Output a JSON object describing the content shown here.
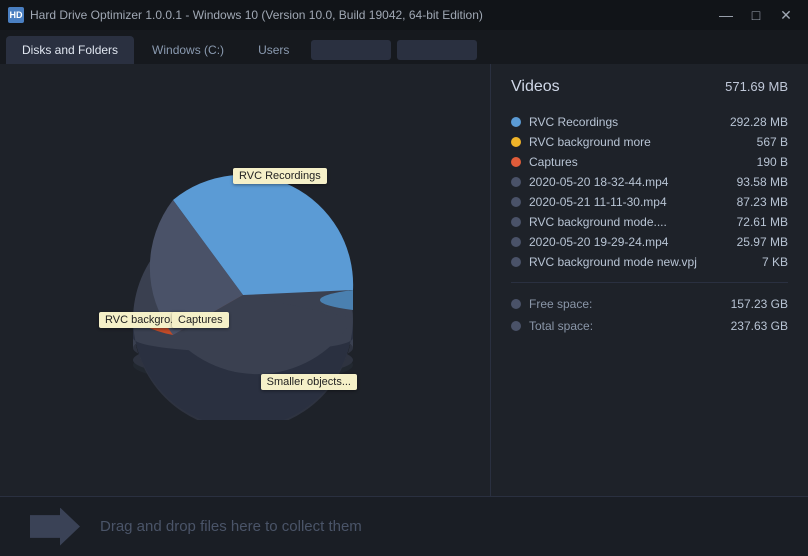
{
  "titleBar": {
    "title": "Hard Drive Optimizer 1.0.0.1 - Windows 10 (Version 10.0, Build 19042, 64-bit Edition)",
    "iconLabel": "HD",
    "controls": {
      "minimize": "—",
      "maximize": "□",
      "close": "✕"
    }
  },
  "tabs": [
    {
      "id": "disks-folders",
      "label": "Disks and Folders",
      "active": true
    },
    {
      "id": "windows-c",
      "label": "Windows (C:)",
      "active": false
    },
    {
      "id": "users",
      "label": "Users",
      "active": false
    }
  ],
  "chart": {
    "labels": {
      "rvcRecordings": "RVC Recordings",
      "rvcBackground": "RVC backgro...",
      "captures": "Captures",
      "smallerObjects": "Smaller objects..."
    }
  },
  "rightPanel": {
    "sectionTitle": "Videos",
    "sectionSize": "571.69 MB",
    "items": [
      {
        "color": "#5b9bd5",
        "name": "RVC Recordings",
        "size": "292.28 MB"
      },
      {
        "color": "#f0b429",
        "name": "RVC background more",
        "size": "567 B"
      },
      {
        "color": "#e05c3a",
        "name": "Captures",
        "size": "190 B"
      },
      {
        "color": "#4a5268",
        "name": "2020-05-20 18-32-44.mp4",
        "size": "93.58 MB"
      },
      {
        "color": "#4a5268",
        "name": "2020-05-21 11-11-30.mp4",
        "size": "87.23 MB"
      },
      {
        "color": "#4a5268",
        "name": "RVC background mode....",
        "size": "72.61 MB"
      },
      {
        "color": "#4a5268",
        "name": "2020-05-20 19-29-24.mp4",
        "size": "25.97 MB"
      },
      {
        "color": "#4a5268",
        "name": "RVC background mode new.vpj",
        "size": "7 KB"
      }
    ],
    "diskInfo": [
      {
        "color": "#4a5268",
        "label": "Free space:",
        "size": "157.23 GB"
      },
      {
        "color": "#4a5268",
        "label": "Total space:",
        "size": "237.63 GB"
      }
    ]
  },
  "dropZone": {
    "text": "Drag and drop files here to collect them"
  }
}
